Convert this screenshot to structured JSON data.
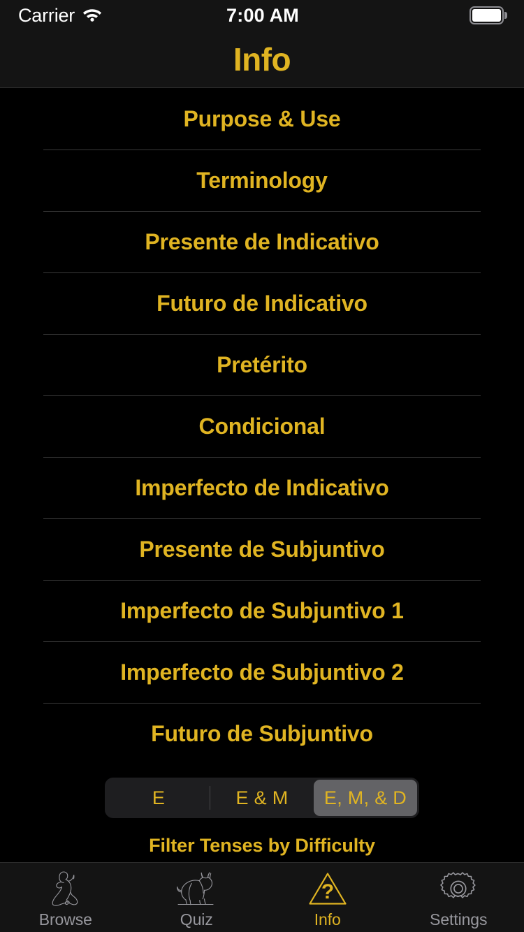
{
  "colors": {
    "accent_gold": "#e0b422",
    "background": "#000000",
    "bar_background": "#141414",
    "separator": "#3a3a3a",
    "inactive_tab": "#98989e",
    "segment_track": "#1e1e20",
    "segment_selected": "#636366"
  },
  "status_bar": {
    "carrier": "Carrier",
    "wifi_icon": "wifi-icon",
    "time": "7:00 AM",
    "battery_icon": "battery-full-icon"
  },
  "nav_bar": {
    "title": "Info"
  },
  "list": {
    "rows": [
      {
        "label": "Purpose & Use"
      },
      {
        "label": "Terminology"
      },
      {
        "label": "Presente de Indicativo"
      },
      {
        "label": "Futuro de Indicativo"
      },
      {
        "label": "Pretérito"
      },
      {
        "label": "Condicional"
      },
      {
        "label": "Imperfecto de Indicativo"
      },
      {
        "label": "Presente de Subjuntivo"
      },
      {
        "label": "Imperfecto de Subjuntivo 1"
      },
      {
        "label": "Imperfecto de Subjuntivo 2"
      },
      {
        "label": "Futuro de Subjuntivo"
      }
    ]
  },
  "filter": {
    "segments": [
      {
        "label": "E",
        "selected": false
      },
      {
        "label": "E & M",
        "selected": false
      },
      {
        "label": "E, M, & D",
        "selected": true
      }
    ],
    "selected_value": "E, M, & D",
    "caption": "Filter Tenses by Difficulty"
  },
  "tab_bar": {
    "tabs": [
      {
        "label": "Browse",
        "icon": "flamenco-dancer-icon",
        "active": false
      },
      {
        "label": "Quiz",
        "icon": "bull-icon",
        "active": false
      },
      {
        "label": "Info",
        "icon": "warning-triangle-question-icon",
        "active": true
      },
      {
        "label": "Settings",
        "icon": "gear-icon",
        "active": false
      }
    ]
  }
}
